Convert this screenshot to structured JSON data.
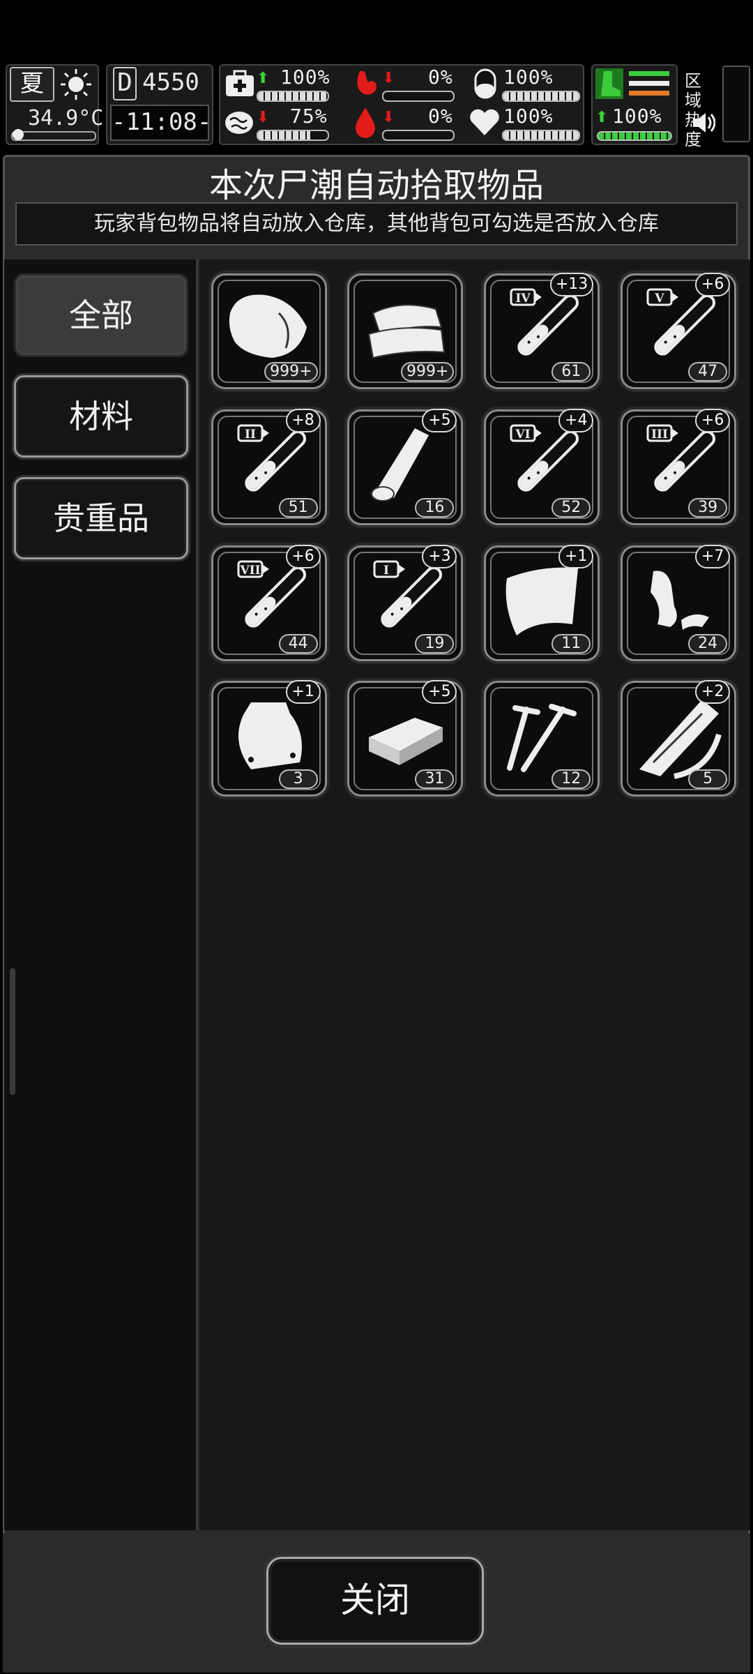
{
  "hud": {
    "season": "夏",
    "temperature": "34.9°C",
    "day_prefix": "D",
    "day_value": "4550",
    "clock": "-11:08-",
    "region_heat_label": "区域\n热度",
    "stats": {
      "health": {
        "value": "100%",
        "trend": "up",
        "fill": 1.0
      },
      "hunger": {
        "value": "0%",
        "trend": "down",
        "fill": 0.0
      },
      "thirst_pill": {
        "value": "100%",
        "fill": 1.0
      },
      "mental": {
        "value": "75%",
        "trend": "down",
        "fill": 0.75
      },
      "blood": {
        "value": "0%",
        "trend": "down",
        "fill": 0.0
      },
      "heart": {
        "value": "100%",
        "fill": 1.0
      },
      "stamina": {
        "value": "100%",
        "trend": "up",
        "fill": 1.0
      }
    },
    "colors": {
      "up": "#3ad33a",
      "down": "#e21b1b",
      "stamina": "#3ccc3c",
      "orange": "#e07b28"
    }
  },
  "dialog": {
    "title": "本次尸潮自动拾取物品",
    "subtitle": "玩家背包物品将自动放入仓库，其他背包可勾选是否放入仓库",
    "close_label": "关闭"
  },
  "tabs": [
    {
      "label": "全部",
      "active": true
    },
    {
      "label": "材料",
      "active": false
    },
    {
      "label": "贵重品",
      "active": false
    }
  ],
  "items": [
    {
      "icon": "meat-icon",
      "count": "999+",
      "bonus": ""
    },
    {
      "icon": "cloth-icon",
      "count": "999+",
      "bonus": ""
    },
    {
      "icon": "test-tube-iv-icon",
      "count": "61",
      "bonus": "+13"
    },
    {
      "icon": "test-tube-v-icon",
      "count": "47",
      "bonus": "+6"
    },
    {
      "icon": "test-tube-ii-icon",
      "count": "51",
      "bonus": "+8"
    },
    {
      "icon": "bandage-roll-icon",
      "count": "16",
      "bonus": "+5"
    },
    {
      "icon": "test-tube-vi-icon",
      "count": "52",
      "bonus": "+4"
    },
    {
      "icon": "test-tube-iii-icon",
      "count": "39",
      "bonus": "+6"
    },
    {
      "icon": "test-tube-vii-icon",
      "count": "44",
      "bonus": "+6"
    },
    {
      "icon": "test-tube-i-icon",
      "count": "19",
      "bonus": "+3"
    },
    {
      "icon": "plastic-sheet-icon",
      "count": "11",
      "bonus": "+1"
    },
    {
      "icon": "scrap-cloth-icon",
      "count": "24",
      "bonus": "+7"
    },
    {
      "icon": "plastic-bag-icon",
      "count": "3",
      "bonus": "+1"
    },
    {
      "icon": "box-icon",
      "count": "31",
      "bonus": "+5"
    },
    {
      "icon": "nails-icon",
      "count": "12",
      "bonus": ""
    },
    {
      "icon": "wood-planks-icon",
      "count": "5",
      "bonus": "+2"
    }
  ]
}
